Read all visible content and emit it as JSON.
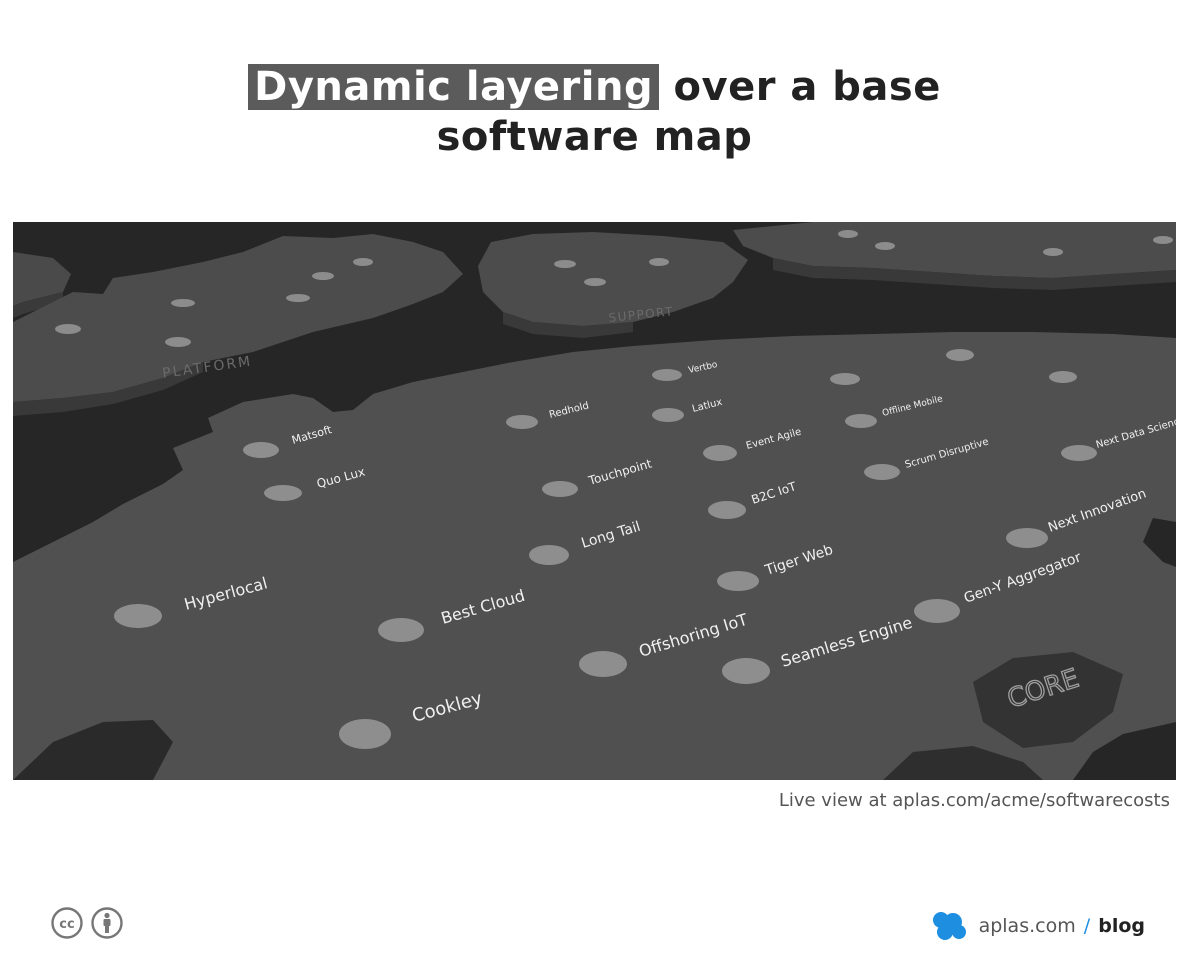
{
  "header": {
    "title_highlight": "Dynamic layering",
    "title_rest_line1": "over a base",
    "title_line2": "software map"
  },
  "map": {
    "core_region_label": "CORE",
    "platform_region_label": "PLATFORM",
    "support_region_label": "SUPPORT",
    "nodes": [
      {
        "label": "Matsoft"
      },
      {
        "label": "Quo Lux"
      },
      {
        "label": "Redhold"
      },
      {
        "label": "Latlux"
      },
      {
        "label": "Vertbo"
      },
      {
        "label": "Touchpoint"
      },
      {
        "label": "Event Agile"
      },
      {
        "label": "Offline Mobile"
      },
      {
        "label": "B2C IoT"
      },
      {
        "label": "Scrum Disruptive"
      },
      {
        "label": "Next Data Science"
      },
      {
        "label": "Hyperlocal"
      },
      {
        "label": "Long Tail"
      },
      {
        "label": "Best Cloud"
      },
      {
        "label": "Tiger Web"
      },
      {
        "label": "Next Innovation"
      },
      {
        "label": "Offshoring IoT"
      },
      {
        "label": "Seamless Engine"
      },
      {
        "label": "Gen-Y Aggregator"
      },
      {
        "label": "Cookley"
      }
    ]
  },
  "caption": "Live view at aplas.com/acme/softwarecosts",
  "footer": {
    "cc_symbol": "cc",
    "site": "aplas.com",
    "slash": "/",
    "section": "blog",
    "brand_color": "#1e8fe0"
  }
}
